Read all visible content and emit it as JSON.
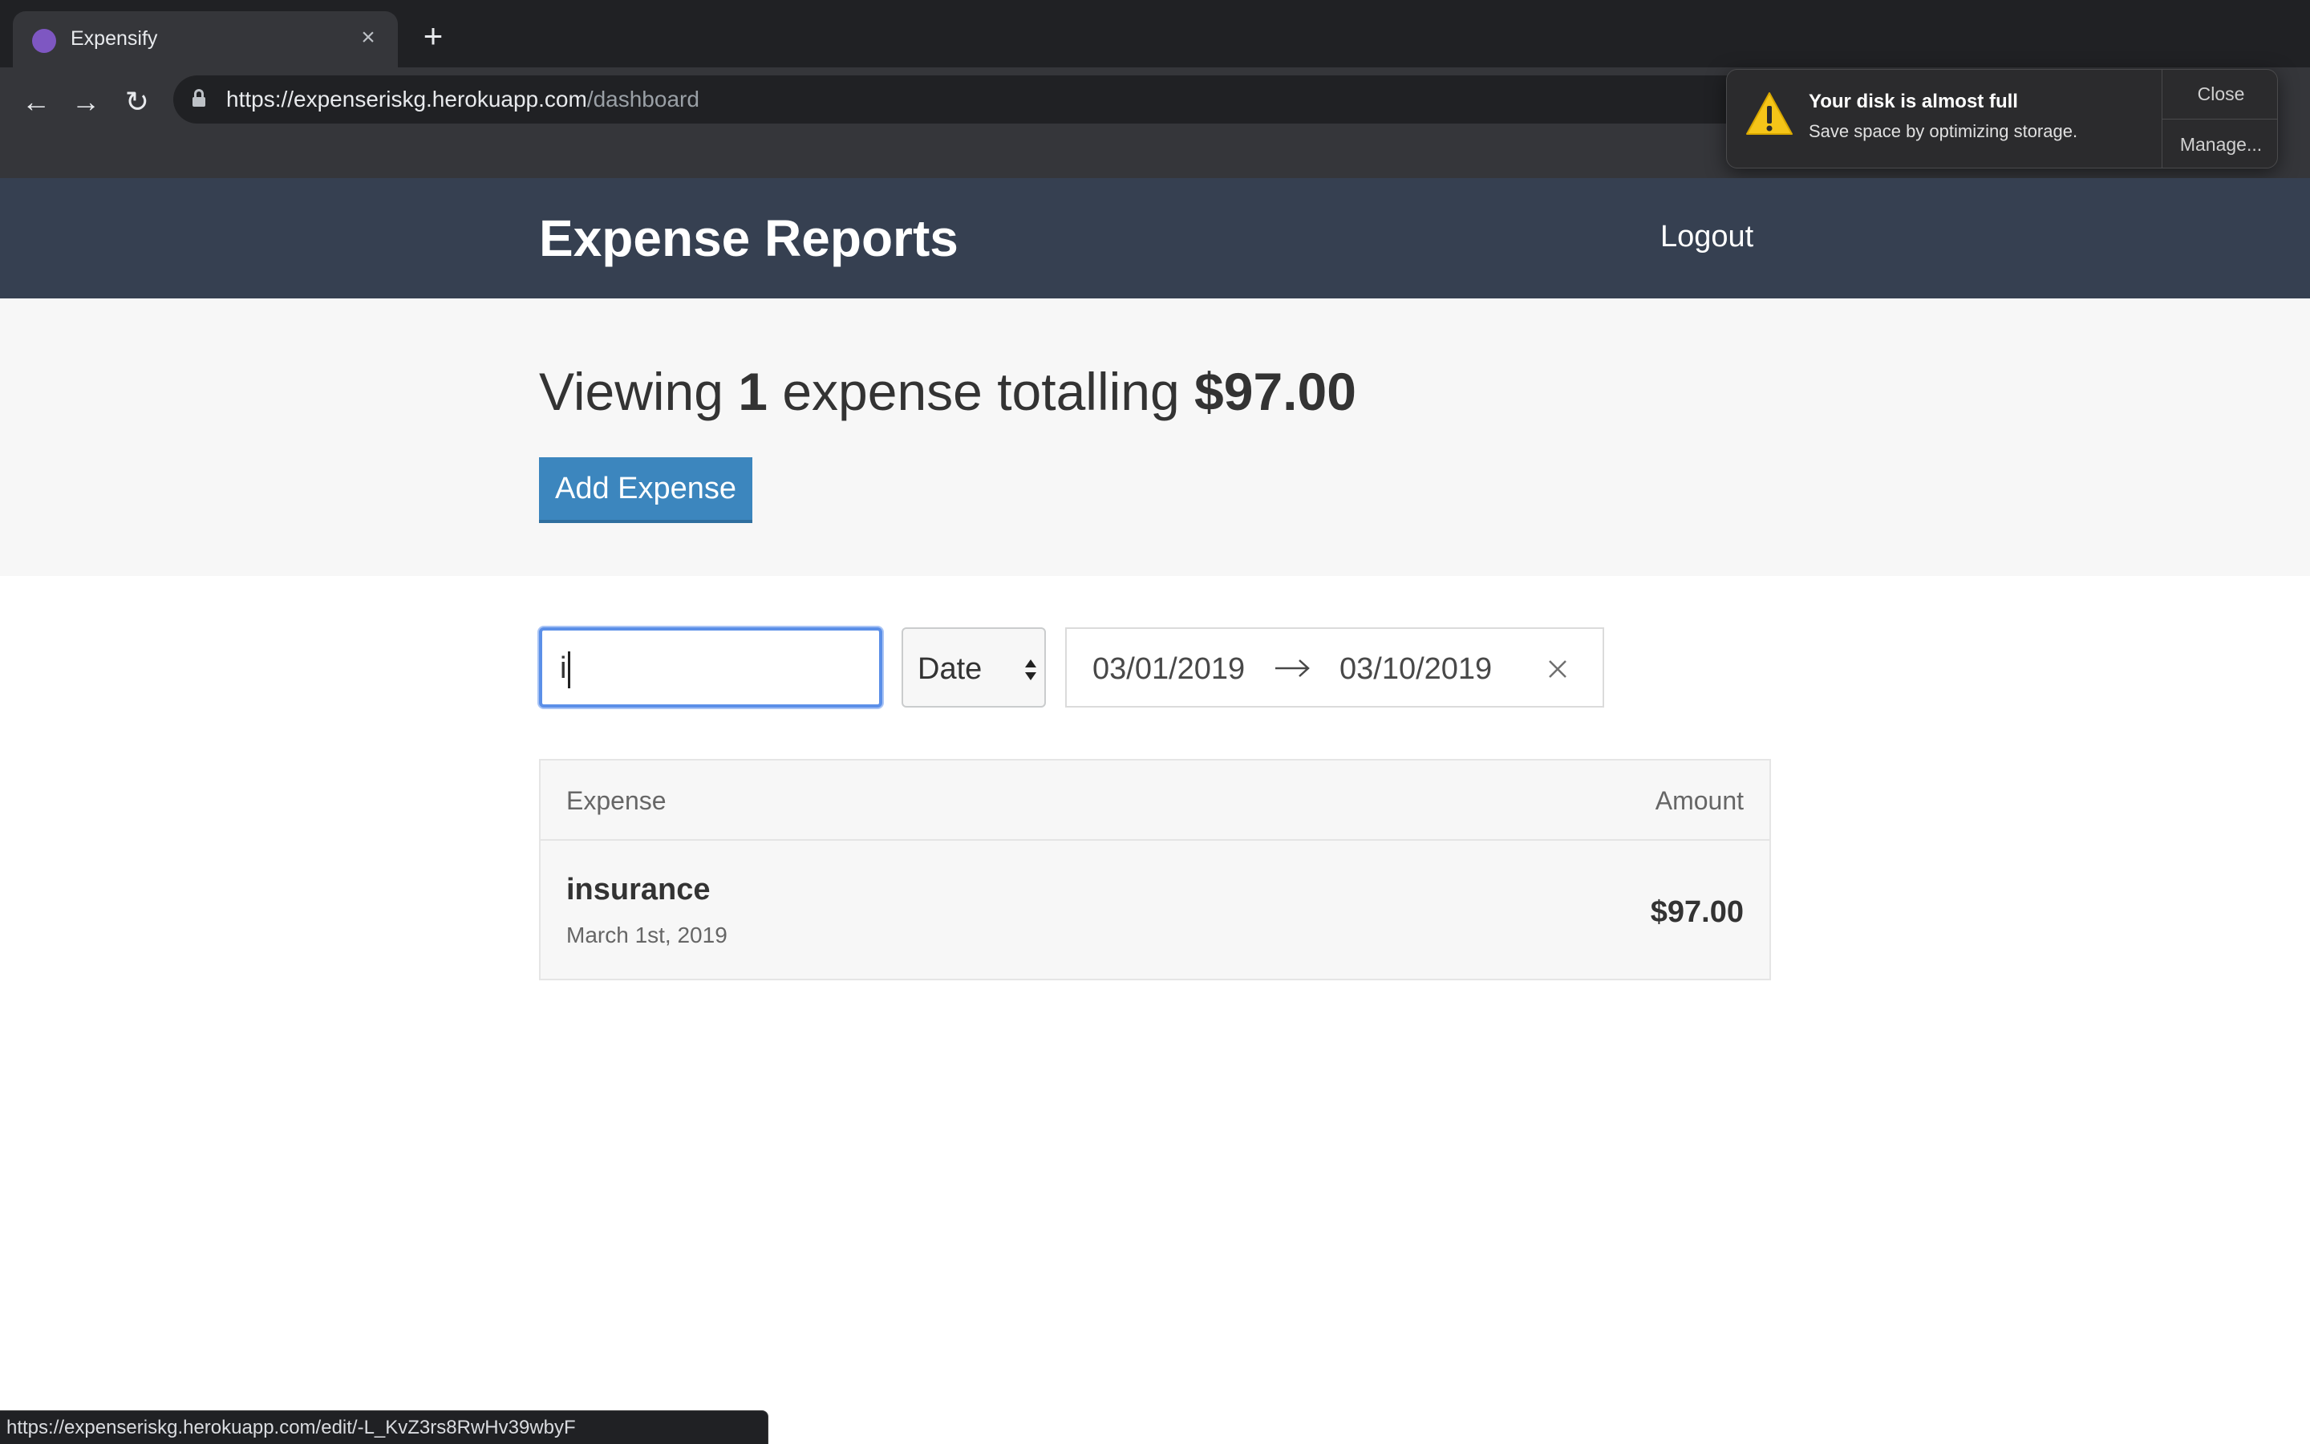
{
  "browser": {
    "tab_title": "Expensify",
    "url_base": "https://expenseriskg.herokuapp.com",
    "url_path": "/dashboard",
    "status_url": "https://expenseriskg.herokuapp.com/edit/-L_KvZ3rs8RwHv39wbyF"
  },
  "notification": {
    "title": "Your disk is almost full",
    "body": "Save space by optimizing storage.",
    "close_label": "Close",
    "manage_label": "Manage..."
  },
  "header": {
    "title": "Expense Reports",
    "logout_label": "Logout"
  },
  "summary": {
    "prefix": "Viewing",
    "count": "1",
    "middle": "expense totalling",
    "total": "$97.00",
    "add_button": "Add Expense"
  },
  "filters": {
    "text_value": "i",
    "sort_value": "Date",
    "start_date": "03/01/2019",
    "end_date": "03/10/2019"
  },
  "table": {
    "col_expense": "Expense",
    "col_amount": "Amount",
    "rows": [
      {
        "description": "insurance",
        "date": "March 1st, 2019",
        "amount": "$97.00"
      }
    ]
  },
  "colors": {
    "header_bg": "#364051",
    "accent_button": "#3c86be",
    "warning": "#f5c518"
  }
}
